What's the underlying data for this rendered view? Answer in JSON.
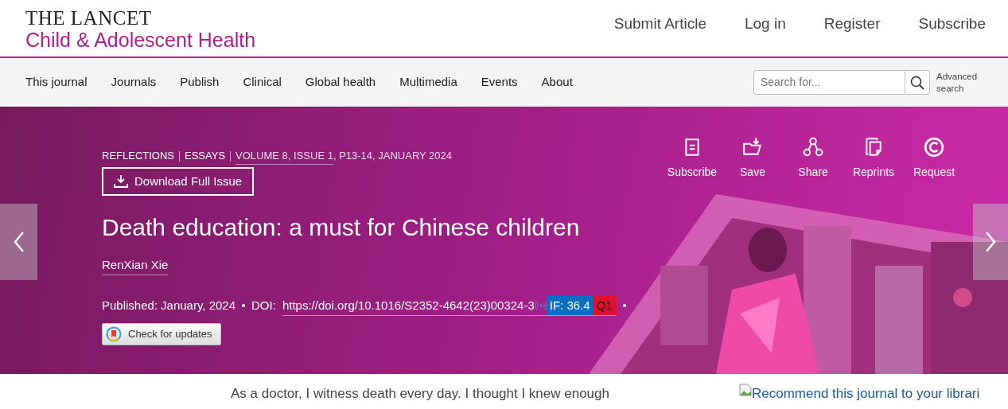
{
  "header": {
    "logo_title": "THE LANCET",
    "logo_subtitle": "Child & Adolescent Health",
    "links": [
      "Submit Article",
      "Log in",
      "Register",
      "Subscribe"
    ]
  },
  "nav": {
    "items": [
      "This journal",
      "Journals",
      "Publish",
      "Clinical",
      "Global health",
      "Multimedia",
      "Events",
      "About"
    ],
    "search": {
      "placeholder": "Search for..."
    },
    "advanced_search": "Advanced search"
  },
  "article": {
    "categories": [
      "REFLECTIONS",
      "ESSAYS"
    ],
    "issue": "VOLUME 8, ISSUE 1",
    "issue_rest": ", P13-14, JANUARY 2024",
    "download_button": "Download Full Issue",
    "title": "Death education: a must for Chinese children",
    "author": "RenXian Xie",
    "published_label": "Published:",
    "published_date": "January, 2024",
    "doi_label": "DOI:",
    "doi": "https://doi.org/10.1016/S2352-4642(23)00324-3",
    "impact_factor": "IF: 36.4",
    "quartile": "Q1",
    "check_updates": "Check for updates",
    "actions": [
      {
        "kind": "subscribe",
        "label": "Subscribe"
      },
      {
        "kind": "save",
        "label": "Save"
      },
      {
        "kind": "share",
        "label": "Share"
      },
      {
        "kind": "reprints",
        "label": "Reprints"
      },
      {
        "kind": "request",
        "label": "Request"
      }
    ]
  },
  "body": {
    "text": "As a doctor, I witness death every day. I thought I knew enough",
    "recommend": "Recommend this journal to your librari"
  }
}
